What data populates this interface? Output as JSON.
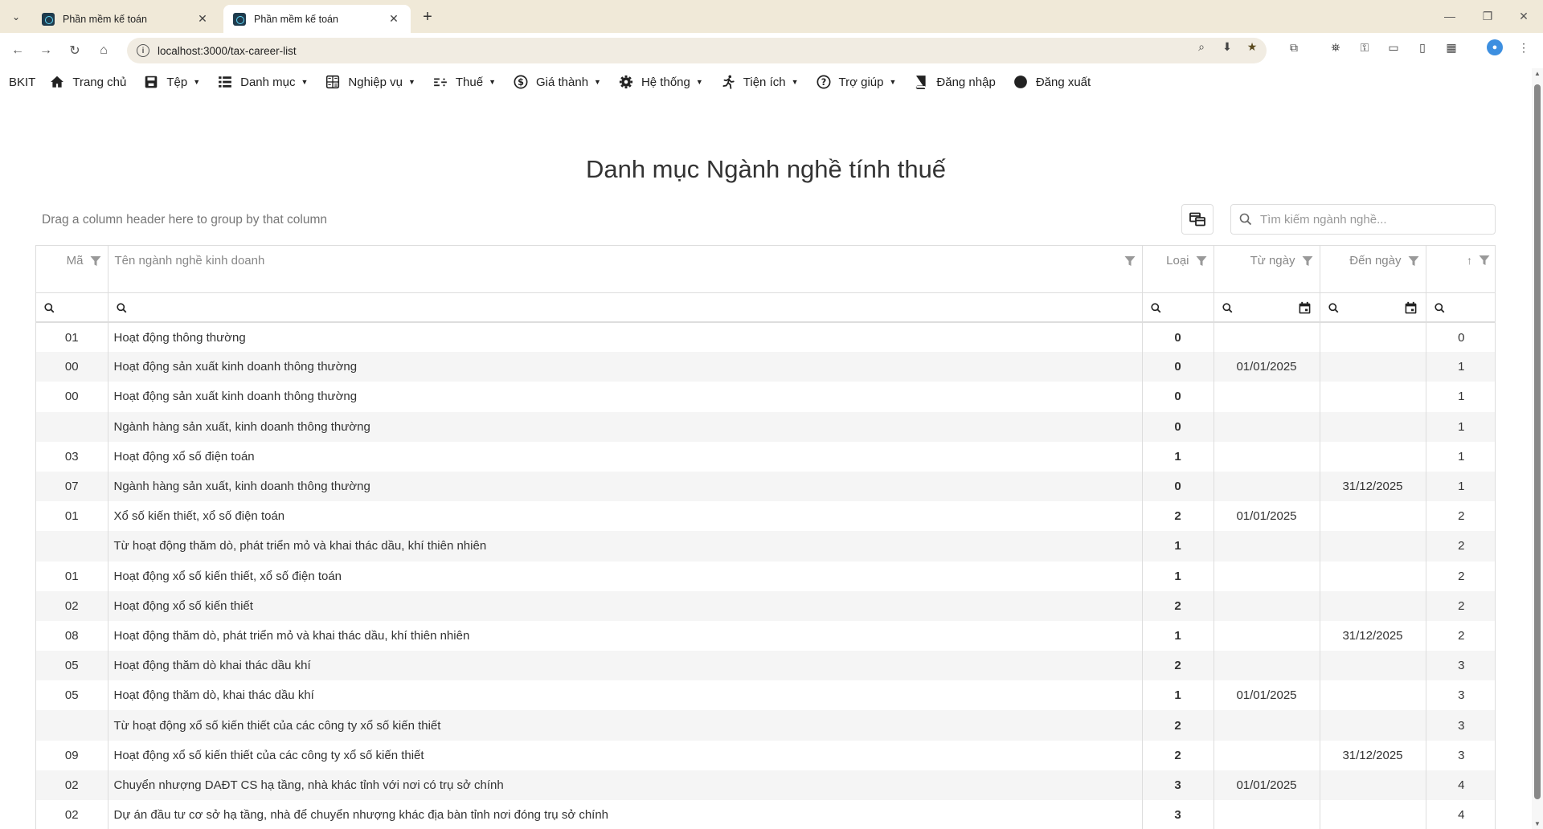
{
  "browser": {
    "tabs": [
      {
        "title": "Phần mềm kế toán",
        "active": false
      },
      {
        "title": "Phần mềm kế toán",
        "active": true
      }
    ],
    "url": "localhost:3000/tax-career-list"
  },
  "menu": {
    "brand": "BKIT",
    "items": [
      {
        "label": "Trang chủ",
        "icon": "home-icon",
        "dropdown": false
      },
      {
        "label": "Tệp",
        "icon": "save-icon",
        "dropdown": true
      },
      {
        "label": "Danh mục",
        "icon": "list-icon",
        "dropdown": true
      },
      {
        "label": "Nghiệp vụ",
        "icon": "calculator-icon",
        "dropdown": true
      },
      {
        "label": "Thuế",
        "icon": "tax-icon",
        "dropdown": true
      },
      {
        "label": "Giá thành",
        "icon": "dollar-icon",
        "dropdown": true
      },
      {
        "label": "Hệ thống",
        "icon": "gear-icon",
        "dropdown": true
      },
      {
        "label": "Tiện ích",
        "icon": "runner-icon",
        "dropdown": true
      },
      {
        "label": "Trợ giúp",
        "icon": "question-icon",
        "dropdown": true
      },
      {
        "label": "Đăng nhập",
        "icon": "book-icon",
        "dropdown": false
      },
      {
        "label": "Đăng xuất",
        "icon": "circle-icon",
        "dropdown": false
      }
    ]
  },
  "page": {
    "title": "Danh mục Ngành nghề tính thuế",
    "group_panel_text": "Drag a column header here to group by that column",
    "search_placeholder": "Tìm kiếm ngành nghề..."
  },
  "grid": {
    "columns": [
      "Mã",
      "Tên ngành nghề kinh doanh",
      "Loại",
      "Từ ngày",
      "Đến ngày",
      ""
    ],
    "rows": [
      {
        "ma": "01",
        "ten": "Hoạt động thông thường",
        "loai": "0",
        "tu_ngay": "",
        "den_ngay": "",
        "nhom": "0"
      },
      {
        "ma": "00",
        "ten": "Hoạt động sản xuất kinh doanh thông thường",
        "loai": "0",
        "tu_ngay": "01/01/2025",
        "den_ngay": "",
        "nhom": "1"
      },
      {
        "ma": "00",
        "ten": "Hoạt động sản xuất kinh doanh thông thường",
        "loai": "0",
        "tu_ngay": "",
        "den_ngay": "",
        "nhom": "1"
      },
      {
        "ma": "",
        "ten": "Ngành hàng sản xuất, kinh doanh thông thường",
        "loai": "0",
        "tu_ngay": "",
        "den_ngay": "",
        "nhom": "1"
      },
      {
        "ma": "03",
        "ten": "Hoạt động xổ số điện toán",
        "loai": "1",
        "tu_ngay": "",
        "den_ngay": "",
        "nhom": "1"
      },
      {
        "ma": "07",
        "ten": "Ngành hàng sản xuất, kinh doanh thông thường",
        "loai": "0",
        "tu_ngay": "",
        "den_ngay": "31/12/2025",
        "nhom": "1"
      },
      {
        "ma": "01",
        "ten": "Xổ số kiến thiết, xổ số điện toán",
        "loai": "2",
        "tu_ngay": "01/01/2025",
        "den_ngay": "",
        "nhom": "2"
      },
      {
        "ma": "",
        "ten": "Từ hoạt động thăm dò, phát triển mỏ và khai thác dầu, khí thiên nhiên",
        "loai": "1",
        "tu_ngay": "",
        "den_ngay": "",
        "nhom": "2"
      },
      {
        "ma": "01",
        "ten": "Hoạt động xổ số kiến thiết, xổ số điện toán",
        "loai": "1",
        "tu_ngay": "",
        "den_ngay": "",
        "nhom": "2"
      },
      {
        "ma": "02",
        "ten": "Hoạt động xổ số kiến thiết",
        "loai": "2",
        "tu_ngay": "",
        "den_ngay": "",
        "nhom": "2"
      },
      {
        "ma": "08",
        "ten": "Hoạt động thăm dò, phát triển mỏ và khai thác dầu, khí thiên nhiên",
        "loai": "1",
        "tu_ngay": "",
        "den_ngay": "31/12/2025",
        "nhom": "2"
      },
      {
        "ma": "05",
        "ten": "Hoạt động thăm dò khai thác dầu khí",
        "loai": "2",
        "tu_ngay": "",
        "den_ngay": "",
        "nhom": "3"
      },
      {
        "ma": "05",
        "ten": "Hoạt động thăm dò, khai thác dầu khí",
        "loai": "1",
        "tu_ngay": "01/01/2025",
        "den_ngay": "",
        "nhom": "3"
      },
      {
        "ma": "",
        "ten": "Từ hoạt động xổ số kiến thiết của các công ty xổ số kiến thiết",
        "loai": "2",
        "tu_ngay": "",
        "den_ngay": "",
        "nhom": "3"
      },
      {
        "ma": "09",
        "ten": "Hoạt động xổ số kiến thiết của các công ty xổ số kiến thiết",
        "loai": "2",
        "tu_ngay": "",
        "den_ngay": "31/12/2025",
        "nhom": "3"
      },
      {
        "ma": "02",
        "ten": "Chuyển nhượng DAĐT CS hạ tầng, nhà khác tỉnh với nơi có trụ sở chính",
        "loai": "3",
        "tu_ngay": "01/01/2025",
        "den_ngay": "",
        "nhom": "4"
      },
      {
        "ma": "02",
        "ten": "Dự án đầu tư cơ sở hạ tầng, nhà để chuyển nhượng khác địa bàn tỉnh nơi đóng trụ sở chính",
        "loai": "3",
        "tu_ngay": "",
        "den_ngay": "",
        "nhom": "4"
      }
    ]
  }
}
